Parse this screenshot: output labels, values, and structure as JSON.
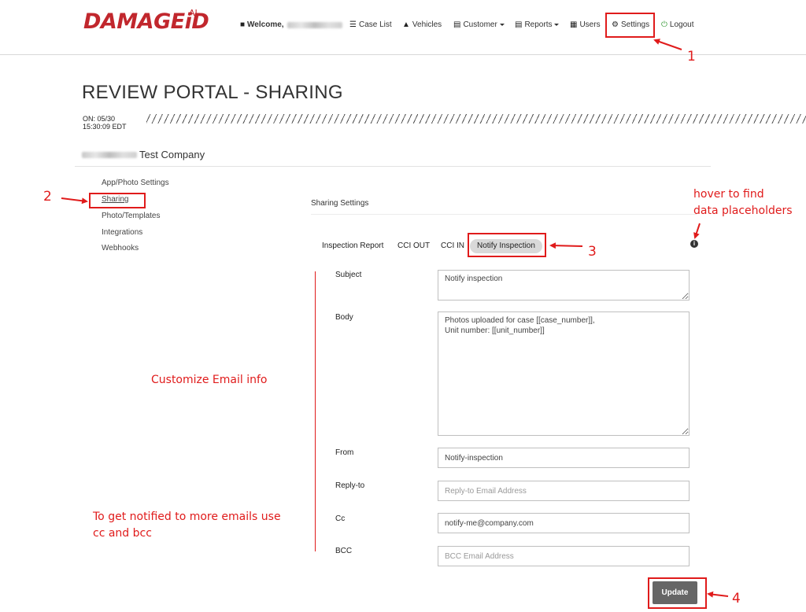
{
  "brand": {
    "logo_text": "DAMAGEiD",
    "logo_suffix": "AI",
    "color": "#c1272d"
  },
  "nav": {
    "welcome_label": "Welcome,",
    "items": [
      {
        "label": "Case List",
        "icon": "list-icon"
      },
      {
        "label": "Vehicles",
        "icon": "car-icon"
      },
      {
        "label": "Customer",
        "icon": "list-icon",
        "dropdown": true
      },
      {
        "label": "Reports",
        "icon": "report-icon",
        "dropdown": true
      },
      {
        "label": "Users",
        "icon": "grid-icon"
      },
      {
        "label": "Settings",
        "icon": "gear-icon"
      },
      {
        "label": "Logout",
        "icon": "power-icon"
      }
    ]
  },
  "page": {
    "title": "REVIEW PORTAL - SHARING",
    "timestamp_line1": "ON: 05/30",
    "timestamp_line2": "15:30:09 EDT",
    "company_name": "Test Company"
  },
  "side_menu": {
    "items": [
      {
        "label": "App/Photo Settings"
      },
      {
        "label": "Sharing",
        "active": true
      },
      {
        "label": "Photo/Templates"
      },
      {
        "label": "Integrations"
      },
      {
        "label": "Webhooks"
      }
    ]
  },
  "sharing": {
    "section_title": "Sharing Settings",
    "tabs": [
      {
        "label": "Inspection Report"
      },
      {
        "label": "CCI OUT"
      },
      {
        "label": "CCI IN"
      },
      {
        "label": "Notify Inspection",
        "active": true
      }
    ],
    "fields": {
      "subject": {
        "label": "Subject",
        "value": "Notify inspection"
      },
      "body": {
        "label": "Body",
        "value": "Photos uploaded for case [[case_number]],\nUnit number: [[unit_number]]"
      },
      "from": {
        "label": "From",
        "value": "Notify-inspection"
      },
      "reply_to": {
        "label": "Reply-to",
        "value": "",
        "placeholder": "Reply-to Email Address"
      },
      "cc": {
        "label": "Cc",
        "value": "notify-me@company.com"
      },
      "bcc": {
        "label": "BCC",
        "value": "",
        "placeholder": "BCC Email Address"
      }
    },
    "update_label": "Update"
  },
  "annotations": {
    "num1": "1",
    "num2": "2",
    "num3": "3",
    "num4": "4",
    "hover_line1": "hover to find",
    "hover_line2": "data placeholders",
    "customize": "Customize Email info",
    "cc_line1": "To get notified to more emails use",
    "cc_line2": "cc and bcc",
    "color": "#e01b1b"
  }
}
